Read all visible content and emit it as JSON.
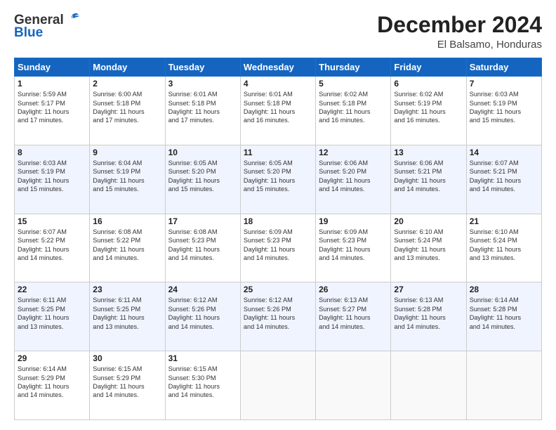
{
  "header": {
    "logo_general": "General",
    "logo_blue": "Blue",
    "title": "December 2024",
    "subtitle": "El Balsamo, Honduras"
  },
  "days": [
    "Sunday",
    "Monday",
    "Tuesday",
    "Wednesday",
    "Thursday",
    "Friday",
    "Saturday"
  ],
  "weeks": [
    [
      {
        "num": "1",
        "text": "Sunrise: 5:59 AM\nSunset: 5:17 PM\nDaylight: 11 hours\nand 17 minutes."
      },
      {
        "num": "2",
        "text": "Sunrise: 6:00 AM\nSunset: 5:18 PM\nDaylight: 11 hours\nand 17 minutes."
      },
      {
        "num": "3",
        "text": "Sunrise: 6:01 AM\nSunset: 5:18 PM\nDaylight: 11 hours\nand 17 minutes."
      },
      {
        "num": "4",
        "text": "Sunrise: 6:01 AM\nSunset: 5:18 PM\nDaylight: 11 hours\nand 16 minutes."
      },
      {
        "num": "5",
        "text": "Sunrise: 6:02 AM\nSunset: 5:18 PM\nDaylight: 11 hours\nand 16 minutes."
      },
      {
        "num": "6",
        "text": "Sunrise: 6:02 AM\nSunset: 5:19 PM\nDaylight: 11 hours\nand 16 minutes."
      },
      {
        "num": "7",
        "text": "Sunrise: 6:03 AM\nSunset: 5:19 PM\nDaylight: 11 hours\nand 15 minutes."
      }
    ],
    [
      {
        "num": "8",
        "text": "Sunrise: 6:03 AM\nSunset: 5:19 PM\nDaylight: 11 hours\nand 15 minutes."
      },
      {
        "num": "9",
        "text": "Sunrise: 6:04 AM\nSunset: 5:19 PM\nDaylight: 11 hours\nand 15 minutes."
      },
      {
        "num": "10",
        "text": "Sunrise: 6:05 AM\nSunset: 5:20 PM\nDaylight: 11 hours\nand 15 minutes."
      },
      {
        "num": "11",
        "text": "Sunrise: 6:05 AM\nSunset: 5:20 PM\nDaylight: 11 hours\nand 15 minutes."
      },
      {
        "num": "12",
        "text": "Sunrise: 6:06 AM\nSunset: 5:20 PM\nDaylight: 11 hours\nand 14 minutes."
      },
      {
        "num": "13",
        "text": "Sunrise: 6:06 AM\nSunset: 5:21 PM\nDaylight: 11 hours\nand 14 minutes."
      },
      {
        "num": "14",
        "text": "Sunrise: 6:07 AM\nSunset: 5:21 PM\nDaylight: 11 hours\nand 14 minutes."
      }
    ],
    [
      {
        "num": "15",
        "text": "Sunrise: 6:07 AM\nSunset: 5:22 PM\nDaylight: 11 hours\nand 14 minutes."
      },
      {
        "num": "16",
        "text": "Sunrise: 6:08 AM\nSunset: 5:22 PM\nDaylight: 11 hours\nand 14 minutes."
      },
      {
        "num": "17",
        "text": "Sunrise: 6:08 AM\nSunset: 5:23 PM\nDaylight: 11 hours\nand 14 minutes."
      },
      {
        "num": "18",
        "text": "Sunrise: 6:09 AM\nSunset: 5:23 PM\nDaylight: 11 hours\nand 14 minutes."
      },
      {
        "num": "19",
        "text": "Sunrise: 6:09 AM\nSunset: 5:23 PM\nDaylight: 11 hours\nand 14 minutes."
      },
      {
        "num": "20",
        "text": "Sunrise: 6:10 AM\nSunset: 5:24 PM\nDaylight: 11 hours\nand 13 minutes."
      },
      {
        "num": "21",
        "text": "Sunrise: 6:10 AM\nSunset: 5:24 PM\nDaylight: 11 hours\nand 13 minutes."
      }
    ],
    [
      {
        "num": "22",
        "text": "Sunrise: 6:11 AM\nSunset: 5:25 PM\nDaylight: 11 hours\nand 13 minutes."
      },
      {
        "num": "23",
        "text": "Sunrise: 6:11 AM\nSunset: 5:25 PM\nDaylight: 11 hours\nand 13 minutes."
      },
      {
        "num": "24",
        "text": "Sunrise: 6:12 AM\nSunset: 5:26 PM\nDaylight: 11 hours\nand 14 minutes."
      },
      {
        "num": "25",
        "text": "Sunrise: 6:12 AM\nSunset: 5:26 PM\nDaylight: 11 hours\nand 14 minutes."
      },
      {
        "num": "26",
        "text": "Sunrise: 6:13 AM\nSunset: 5:27 PM\nDaylight: 11 hours\nand 14 minutes."
      },
      {
        "num": "27",
        "text": "Sunrise: 6:13 AM\nSunset: 5:28 PM\nDaylight: 11 hours\nand 14 minutes."
      },
      {
        "num": "28",
        "text": "Sunrise: 6:14 AM\nSunset: 5:28 PM\nDaylight: 11 hours\nand 14 minutes."
      }
    ],
    [
      {
        "num": "29",
        "text": "Sunrise: 6:14 AM\nSunset: 5:29 PM\nDaylight: 11 hours\nand 14 minutes."
      },
      {
        "num": "30",
        "text": "Sunrise: 6:15 AM\nSunset: 5:29 PM\nDaylight: 11 hours\nand 14 minutes."
      },
      {
        "num": "31",
        "text": "Sunrise: 6:15 AM\nSunset: 5:30 PM\nDaylight: 11 hours\nand 14 minutes."
      },
      null,
      null,
      null,
      null
    ]
  ]
}
